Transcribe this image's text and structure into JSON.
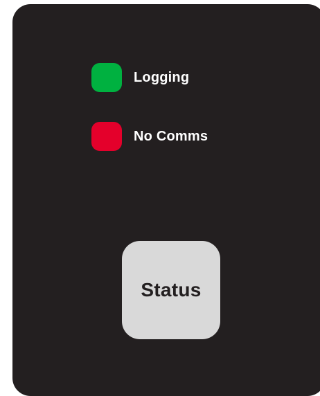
{
  "indicators": [
    {
      "label": "Logging",
      "color": "#00b140",
      "icon": "led-indicator"
    },
    {
      "label": "No Comms",
      "color": "#e4002b",
      "icon": "led-indicator"
    }
  ],
  "status_button": {
    "label": "Status",
    "color": "#d9d9d9"
  },
  "panel": {
    "color": "#231f20"
  }
}
